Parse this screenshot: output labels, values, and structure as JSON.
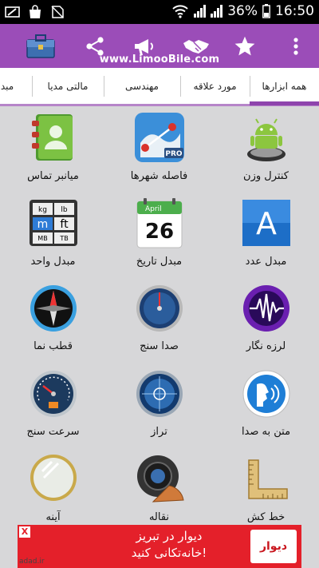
{
  "status_bar": {
    "battery": "36%",
    "time": "16:50"
  },
  "app_bar": {
    "site": "www.LimooBile.com",
    "icons": [
      "toolbox-icon",
      "share-icon",
      "megaphone-icon",
      "handshake-icon",
      "star-icon",
      "overflow-menu-icon"
    ]
  },
  "tabs": [
    {
      "label": "همه ابزارها",
      "selected": true
    },
    {
      "label": "مورد علاقه",
      "selected": false
    },
    {
      "label": "مهندسی",
      "selected": false
    },
    {
      "label": "مالتی مدیا",
      "selected": false
    },
    {
      "label": "مبد",
      "selected": false
    }
  ],
  "tools": [
    {
      "label": "کنترل وزن",
      "icon": "android-scale-icon"
    },
    {
      "label": "فاصله شهرها",
      "icon": "map-distance-icon"
    },
    {
      "label": "میانبر تماس",
      "icon": "contact-book-icon"
    },
    {
      "label": "مبدل عدد",
      "icon": "letter-a-icon"
    },
    {
      "label": "مبدل تاریخ",
      "icon": "calendar-icon"
    },
    {
      "label": "مبدل واحد",
      "icon": "unit-converter-icon"
    },
    {
      "label": "لرزه نگار",
      "icon": "seismograph-icon"
    },
    {
      "label": "صدا سنج",
      "icon": "sound-meter-icon"
    },
    {
      "label": "قطب نما",
      "icon": "compass-icon"
    },
    {
      "label": "متن به صدا",
      "icon": "text-to-speech-icon"
    },
    {
      "label": "تراز",
      "icon": "level-icon"
    },
    {
      "label": "سرعت سنج",
      "icon": "speedometer-icon"
    },
    {
      "label": "خط کش",
      "icon": "ruler-icon"
    },
    {
      "label": "نقاله",
      "icon": "protractor-icon"
    },
    {
      "label": "آینه",
      "icon": "mirror-icon"
    }
  ],
  "calendar": {
    "month": "April",
    "day": "26"
  },
  "unit_converter": {
    "cells": [
      "kg",
      "lb",
      "m",
      "ft",
      "MB",
      "TB"
    ]
  },
  "letter_icon": {
    "letter": "A"
  },
  "map_icon": {
    "badge": "PRO"
  },
  "ad": {
    "line1": "دیوار در تبریز",
    "line2": "خانه‌تکانی کنید!",
    "logo": "دیوار",
    "close": "X",
    "source": "adad.ir"
  },
  "colors": {
    "app_bar": "#9b4db8",
    "tab_indicator": "#8e44ad",
    "background": "#d7d7d9",
    "ad": "#e4202a"
  }
}
